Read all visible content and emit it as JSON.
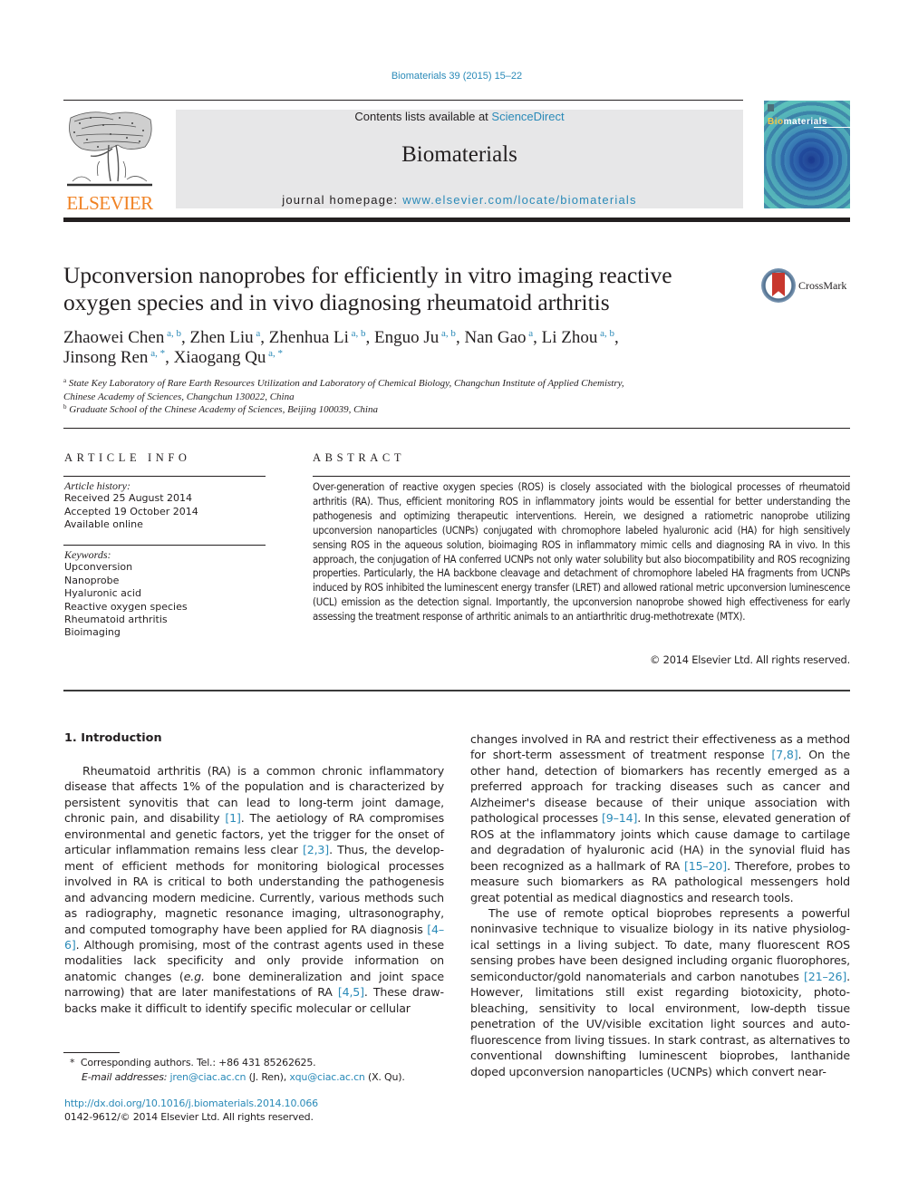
{
  "header": {
    "citation": "Biomaterials 39 (2015) 15–22",
    "contents_prefix": "Contents lists available at ",
    "contents_link": "ScienceDirect",
    "journal_name": "Biomaterials",
    "homepage_prefix": "journal homepage: ",
    "homepage_link": "www.elsevier.com/locate/biomaterials",
    "publisher_logo_text": "ELSEVIER",
    "cover_title_highlight": "Bio",
    "cover_title_rest": "materials",
    "crossmark_label": "CrossMark"
  },
  "article": {
    "title": "Upconversion nanoprobes for efficiently in vitro imaging reactive oxygen species and in vivo diagnosing rheumatoid arthritis",
    "authors": [
      {
        "name": "Zhaowei Chen",
        "aff": "a, b",
        "sep": ", "
      },
      {
        "name": "Zhen Liu",
        "aff": "a",
        "sep": ", "
      },
      {
        "name": "Zhenhua Li",
        "aff": "a, b",
        "sep": ", "
      },
      {
        "name": "Enguo Ju",
        "aff": "a, b",
        "sep": ", "
      },
      {
        "name": "Nan Gao",
        "aff": "a",
        "sep": ", "
      },
      {
        "name": "Li Zhou",
        "aff": "a, b",
        "sep": ","
      },
      {
        "name": "Jinsong Ren",
        "aff": "a, *",
        "sep": ", "
      },
      {
        "name": "Xiaogang Qu",
        "aff": "a, *",
        "sep": ""
      }
    ],
    "affiliations": [
      {
        "mark": "a",
        "line1": "State Key Laboratory of Rare Earth Resources Utilization and Laboratory of Chemical Biology, Changchun Institute of Applied Chemistry,",
        "line2": "Chinese Academy of Sciences, Changchun 130022, China"
      },
      {
        "mark": "b",
        "line1": "Graduate School of the Chinese Academy of Sciences, Beijing 100039, China"
      }
    ]
  },
  "article_info": {
    "heading": "ARTICLE INFO",
    "history_label": "Article history:",
    "history": [
      "Received 25 August 2014",
      "Accepted 19 October 2014",
      "Available online"
    ],
    "keywords_label": "Keywords:",
    "keywords": [
      "Upconversion",
      "Nanoprobe",
      "Hyaluronic acid",
      "Reactive oxygen species",
      "Rheumatoid arthritis",
      "Bioimaging"
    ]
  },
  "abstract": {
    "heading": "ABSTRACT",
    "text": "Over-generation of reactive oxygen species (ROS) is closely associated with the biological processes of rheumatoid arthritis (RA). Thus, efficient monitoring ROS in inflammatory joints would be essential for better understanding the pathogenesis and optimizing therapeutic interventions. Herein, we designed a ratiometric nanoprobe utilizing upconversion nanoparticles (UCNPs) conjugated with chromophore labeled hyaluronic acid (HA) for high sensitively sensing ROS in the aqueous solution, bioimaging ROS in inflammatory mimic cells and diagnosing RA in vivo. In this approach, the conjugation of HA conferred UCNPs not only water solubility but also biocompatibility and ROS recognizing properties. Particularly, the HA backbone cleavage and detachment of chromophore labeled HA fragments from UCNPs induced by ROS inhibited the luminescent energy transfer (LRET) and allowed rational metric upconversion luminescence (UCL) emission as the detection signal. Importantly, the upconversion nanoprobe showed high effectiveness for early assessing the treatment response of arthritic animals to an antiarthritic drug-methotrexate (MTX).",
    "copyright": "© 2014 Elsevier Ltd. All rights reserved."
  },
  "body": {
    "section_heading": "1.  Introduction",
    "left_paragraphs": [
      [
        {
          "t": "Rheumatoid arthritis (RA) is a common chronic inflammatory disease that affects 1% of the population and is characterized by persistent synovitis that can lead to long-term joint damage, chronic pain, and disability "
        },
        {
          "t": "[1]",
          "ref": true
        },
        {
          "t": ". The aetiology of RA compromises environmental and genetic factors, yet the trigger for the onset of articular inflammation remains less clear "
        },
        {
          "t": "[2,3]",
          "ref": true
        },
        {
          "t": ". Thus, the develop­ment of efficient methods for monitoring biological processes involved in RA is critical to both understanding the pathogenesis and advancing modern medicine. Currently, various methods such as radiography, magnetic resonance imaging, ultrasonography, and computed tomography have been applied for RA diagnosis "
        },
        {
          "t": "[4–6]",
          "ref": true
        },
        {
          "t": ". Although promising, most of the contrast agents used in these modalities lack specificity and only provide information on anatomic changes ("
        },
        {
          "t": "e.g.",
          "it": true
        },
        {
          "t": " bone demineralization and joint space narrowing) that are later manifestations of RA "
        },
        {
          "t": "[4,5]",
          "ref": true
        },
        {
          "t": ". These draw­backs make it difficult to identify specific molecular or cellular"
        }
      ]
    ],
    "right_paragraphs": [
      [
        {
          "t": "changes involved in RA and restrict their effectiveness as a method for short-term assessment of treatment response "
        },
        {
          "t": "[7,8]",
          "ref": true
        },
        {
          "t": ". On the other hand, detection of biomarkers has recently emerged as a preferred approach for tracking diseases such as cancer and Alzheimer's disease because of their unique association with pathological pro­cesses "
        },
        {
          "t": "[9–14]",
          "ref": true
        },
        {
          "t": ". In this sense, elevated generation of ROS at the in­flammatory joints which cause damage to cartilage and degradation of hyaluronic acid (HA) in the synovial fluid has been recognized as a hallmark of RA "
        },
        {
          "t": "[15–20]",
          "ref": true
        },
        {
          "t": ". Therefore, probes to measure such biomarkers as RA pathological messengers hold great potential as medical diagnostics and research tools."
        }
      ],
      [
        {
          "t": "The use of remote optical bioprobes represents a powerful noninvasive technique to visualize biology in its native physiolog­ical settings in a living subject. To date, many fluorescent ROS sensing probes have been designed including organic fluorophores, semiconductor/gold nanomaterials and carbon nanotubes "
        },
        {
          "t": "[21–26]",
          "ref": true
        },
        {
          "t": ". However, limitations still exist regarding biotoxicity, photo­bleaching, sensitivity to local environment, low-depth tissue penetration of the UV/visible excitation light sources and auto­fluorescence from living tissues. In stark contrast, as alternatives to conventional downshifting luminescent bioprobes, lanthanide doped upconversion nanoparticles (UCNPs) which convert near-"
        }
      ]
    ]
  },
  "footnotes": {
    "star": "*",
    "corresponding": "Corresponding authors. Tel.: +86 431 85262625.",
    "email_label": "E-mail addresses:",
    "emails": [
      {
        "addr": "jren@ciac.ac.cn",
        "who": "(J. Ren)",
        "sep": ", "
      },
      {
        "addr": "xqu@ciac.ac.cn",
        "who": "(X. Qu).",
        "sep": ""
      }
    ],
    "doi": "http://dx.doi.org/10.1016/j.biomaterials.2014.10.066",
    "issn_line": "0142-9612/© 2014 Elsevier Ltd. All rights reserved."
  },
  "colors": {
    "link": "#2a8ab8",
    "elsevier_orange": "#f08224",
    "box_grey": "#e7e7e8",
    "text": "#231f20"
  }
}
